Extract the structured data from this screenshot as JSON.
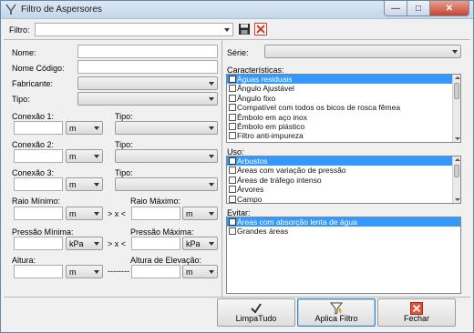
{
  "window": {
    "title": "Filtro de Aspersores"
  },
  "filter": {
    "label": "Filtro:",
    "value": ""
  },
  "left": {
    "nome_label": "Nome:",
    "nome_codigo_label": "Nome Código:",
    "fabricante_label": "Fabricante:",
    "tipo_label": "Tipo:",
    "conexao1_label": "Conexão 1:",
    "conexao2_label": "Conexão 2:",
    "conexao3_label": "Conexão 3:",
    "tipo_col_label": "Tipo:",
    "unit_m": "m",
    "unit_kpa": "kPa",
    "raio_minimo_label": "Raio Mínimo:",
    "raio_maximo_label": "Raio Máximo:",
    "pressao_minima_label": "Pressão Mínima:",
    "pressao_maxima_label": "Pressão Máxima:",
    "range_sep": "> x <",
    "altura_label": "Altura:",
    "altura_elevacao_label": "Altura de Elevação:",
    "dash_sep": "--------"
  },
  "right": {
    "serie_label": "Série:",
    "caracteristicas_label": "Características:",
    "caracteristicas": [
      {
        "label": "Águas residuais",
        "selected": true
      },
      {
        "label": "Ângulo Ajustável",
        "selected": false
      },
      {
        "label": "Ângulo fixo",
        "selected": false
      },
      {
        "label": "Compatível com todos os bicos de rosca fêmea",
        "selected": false
      },
      {
        "label": "Êmbolo em aço inox",
        "selected": false
      },
      {
        "label": "Êmbolo em plástico",
        "selected": false
      },
      {
        "label": "Filtro anti-impureza",
        "selected": false
      }
    ],
    "uso_label": "Uso:",
    "uso": [
      {
        "label": "Arbustos",
        "selected": true
      },
      {
        "label": "Áreas com variação de pressão",
        "selected": false
      },
      {
        "label": "Áreas de tráfego intenso",
        "selected": false
      },
      {
        "label": "Árvores",
        "selected": false
      },
      {
        "label": "Campo",
        "selected": false
      }
    ],
    "evitar_label": "Evitar:",
    "evitar": [
      {
        "label": "Áreas com absorção lenta de água",
        "selected": true
      },
      {
        "label": "Grandes áreas",
        "selected": false
      }
    ]
  },
  "buttons": {
    "limpa_tudo": "LimpaTudo",
    "aplica_filtro": "Aplica Filtro",
    "fechar": "Fechar"
  },
  "icons": {
    "app": "sprinkler-icon",
    "save": "save-icon",
    "clear": "clear-x-icon",
    "check": "checkmark-icon",
    "funnel": "funnel-icon",
    "close": "close-x-icon"
  },
  "colors": {
    "selection": "#3399ff",
    "titlebar": "#c3d6ea",
    "close_red": "#c7432e"
  }
}
